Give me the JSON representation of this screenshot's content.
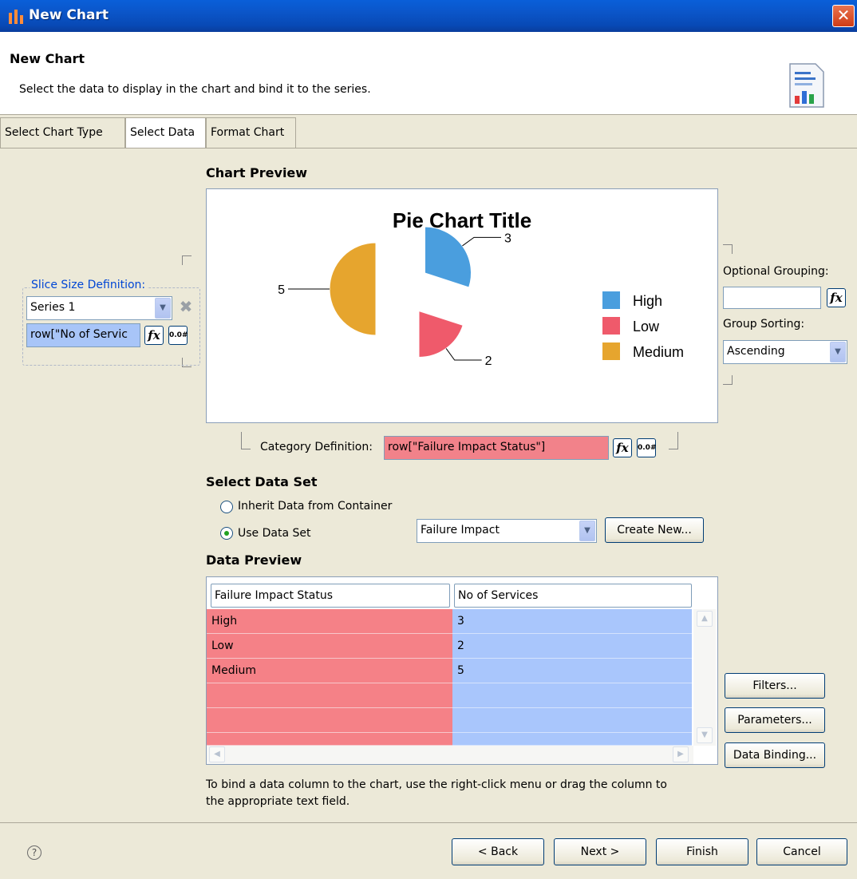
{
  "window": {
    "title": "New Chart",
    "close_glyph": "✕"
  },
  "header": {
    "title": "New Chart",
    "description": "Select the data to display in the chart and bind it to the series."
  },
  "tabs": [
    {
      "label": "Select Chart Type",
      "active": false
    },
    {
      "label": "Select Data",
      "active": true
    },
    {
      "label": "Format Chart",
      "active": false
    }
  ],
  "chart_preview": {
    "section_title": "Chart Preview",
    "chart_data": {
      "type": "pie",
      "title": "Pie Chart Title",
      "categories": [
        "High",
        "Low",
        "Medium"
      ],
      "values": [
        3,
        2,
        5
      ],
      "colors": [
        "#4a9ede",
        "#ef5a6b",
        "#e6a52e"
      ],
      "legend_position": "right",
      "data_labels": [
        "3",
        "2",
        "5"
      ],
      "exploded": true
    }
  },
  "slice_size": {
    "legend": "Slice Size Definition:",
    "series_value": "Series 1",
    "expression": "row[\"No of Servic",
    "fx_label": "fx",
    "format_label": "0.0#"
  },
  "optional_grouping": {
    "label": "Optional Grouping:",
    "value": "",
    "fx_label": "fx",
    "sorting_label": "Group Sorting:",
    "sorting_value": "Ascending"
  },
  "category_definition": {
    "label": "Category Definition:",
    "expression": "row[\"Failure Impact Status\"]",
    "fx_label": "fx",
    "format_label": "0.0#"
  },
  "data_set": {
    "section_title": "Select Data Set",
    "inherit_label": "Inherit Data from Container",
    "inherit_checked": false,
    "use_label": "Use Data Set",
    "use_checked": true,
    "selected": "Failure Impact",
    "create_new_label": "Create New..."
  },
  "data_preview": {
    "section_title": "Data Preview",
    "columns": [
      "Failure Impact Status",
      "No of Services"
    ],
    "rows": [
      [
        "High",
        "3"
      ],
      [
        "Low",
        "2"
      ],
      [
        "Medium",
        "5"
      ],
      [
        "",
        ""
      ],
      [
        "",
        ""
      ],
      [
        "",
        ""
      ]
    ]
  },
  "side_buttons": {
    "filters": "Filters...",
    "parameters": "Parameters...",
    "data_binding": "Data Binding..."
  },
  "hint_line1": "To bind a data column to the chart, use the right-click menu or drag the column to",
  "hint_line2": "the appropriate text field.",
  "footer": {
    "help_glyph": "?",
    "back": "< Back",
    "next": "Next >",
    "finish": "Finish",
    "cancel": "Cancel"
  }
}
